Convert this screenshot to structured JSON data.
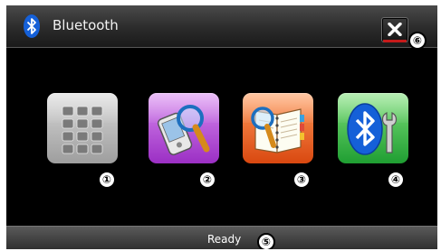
{
  "window": {
    "title": "Bluetooth",
    "close_icon": "close-x-icon",
    "status": "Ready"
  },
  "buttons": [
    {
      "name": "dial-keypad",
      "icon": "keypad-icon",
      "marker": "①"
    },
    {
      "name": "device-search",
      "icon": "phone-search-icon",
      "marker": "②"
    },
    {
      "name": "phonebook",
      "icon": "phonebook-search-icon",
      "marker": "③"
    },
    {
      "name": "bluetooth-settings",
      "icon": "bluetooth-wrench-icon",
      "marker": "④"
    }
  ],
  "markers": {
    "status": "⑤",
    "close": "⑥"
  },
  "colors": {
    "background": "#000000",
    "title_bar": "#2b2b2b",
    "close_accent": "#c61a1a",
    "bluetooth_blue": "#1560d8",
    "keypad_tile": "#bdbdbd",
    "search_tile": "#b84fdc",
    "book_tile": "#f07028",
    "settings_tile": "#3ec04a"
  }
}
